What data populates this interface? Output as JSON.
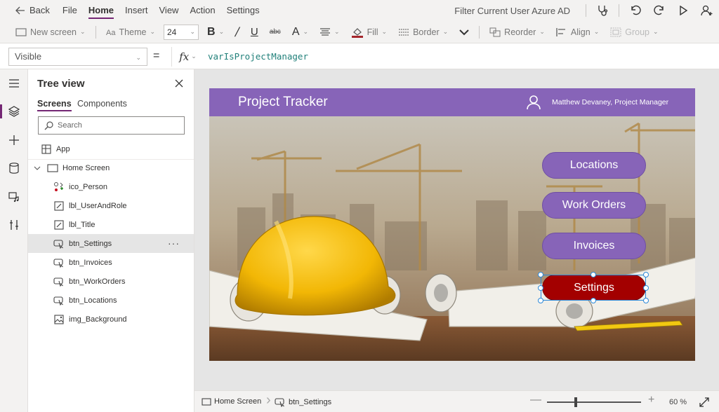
{
  "menu": {
    "back_label": "Back",
    "items": [
      "File",
      "Home",
      "Insert",
      "View",
      "Action",
      "Settings"
    ],
    "active": "Home",
    "app_title": "Filter Current User Azure AD"
  },
  "toolbar": {
    "new_screen": "New screen",
    "theme": "Theme",
    "font_size": "24",
    "fill": "Fill",
    "border": "Border",
    "reorder": "Reorder",
    "align": "Align",
    "group": "Group"
  },
  "formula_bar": {
    "property": "Visible",
    "equals": "=",
    "fx": "fx",
    "formula": "varIsProjectManager"
  },
  "tree_view": {
    "title": "Tree view",
    "tabs": [
      "Screens",
      "Components"
    ],
    "search_placeholder": "Search",
    "app_label": "App",
    "screen_label": "Home Screen",
    "items": [
      {
        "name": "ico_Person",
        "type": "icon"
      },
      {
        "name": "lbl_UserAndRole",
        "type": "label"
      },
      {
        "name": "lbl_Title",
        "type": "label"
      },
      {
        "name": "btn_Settings",
        "type": "button",
        "selected": true
      },
      {
        "name": "btn_Invoices",
        "type": "button"
      },
      {
        "name": "btn_WorkOrders",
        "type": "button"
      },
      {
        "name": "btn_Locations",
        "type": "button"
      },
      {
        "name": "img_Background",
        "type": "image"
      }
    ],
    "more_label": "···"
  },
  "app_screen": {
    "title": "Project Tracker",
    "user_role": "Matthew Devaney, Project Manager",
    "buttons": [
      "Locations",
      "Work Orders",
      "Invoices",
      "Settings"
    ],
    "header_color": "#8764b8",
    "button_color": "#8764b8",
    "settings_color": "#a30000"
  },
  "status_bar": {
    "screen": "Home Screen",
    "control": "btn_Settings",
    "zoom": "60  %",
    "zoom_minus": "—",
    "zoom_plus": "+"
  }
}
